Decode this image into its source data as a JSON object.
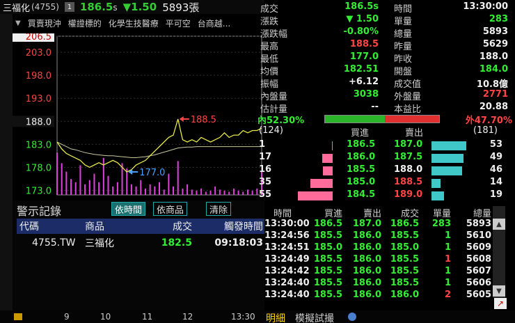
{
  "header": {
    "name": "三福化",
    "code": "(4755)",
    "info_btn": "1",
    "price": "186.5",
    "price_suffix": "s",
    "change": "▼1.50",
    "volume": "5893張"
  },
  "tags": [
    "買賣現沖",
    "權證標的",
    "化學生技醫療",
    "平可空",
    "台商越..."
  ],
  "quote": {
    "rows": [
      [
        {
          "label": "成交",
          "value": "186.5s",
          "color": "green"
        },
        {
          "label": "時間",
          "value": "13:30:00",
          "color": "white"
        }
      ],
      [
        {
          "label": "漲跌",
          "value": "▼ 1.50",
          "color": "green"
        },
        {
          "label": "單量",
          "value": "283",
          "color": "green"
        }
      ],
      [
        {
          "label": "漲跌幅",
          "value": "-0.80%",
          "color": "green"
        },
        {
          "label": "總量",
          "value": "5893",
          "color": "white"
        }
      ],
      [
        {
          "label": "最高",
          "value": "188.5",
          "color": "red"
        },
        {
          "label": "昨量",
          "value": "5629",
          "color": "white"
        }
      ],
      [
        {
          "label": "最低",
          "value": "177.0",
          "color": "green"
        },
        {
          "label": "昨收",
          "value": "188.0",
          "color": "white"
        }
      ],
      [
        {
          "label": "均價",
          "value": "182.51",
          "color": "green"
        },
        {
          "label": "開盤",
          "value": "184.0",
          "color": "green"
        }
      ],
      [
        {
          "label": "振幅",
          "value": "+6.12",
          "color": "white"
        },
        {
          "label": "成交值",
          "value": "10.8億",
          "color": "white"
        }
      ],
      [
        {
          "label": "內盤量",
          "value": "3038",
          "color": "green"
        },
        {
          "label": "外盤量",
          "value": "2771",
          "color": "red"
        }
      ],
      [
        {
          "label": "估計量",
          "value": "--",
          "color": "white"
        },
        {
          "label": "本益比",
          "value": "20.88",
          "color": "white"
        }
      ]
    ],
    "inner_pct": "內52.30%",
    "outer_pct": "外47.70%",
    "inner_ratio": 0.523
  },
  "book": {
    "bid_total": "(124)",
    "ask_total": "(181)",
    "bid_header": "買進",
    "ask_header": "賣出",
    "rows": [
      {
        "bid_qty": "1",
        "bid": "186.5",
        "ask": "187.0",
        "ask_qty": "53",
        "bid_color": "green",
        "ask_color": "green"
      },
      {
        "bid_qty": "17",
        "bid": "186.0",
        "ask": "187.5",
        "ask_qty": "49",
        "bid_color": "green",
        "ask_color": "green"
      },
      {
        "bid_qty": "16",
        "bid": "185.5",
        "ask": "188.0",
        "ask_qty": "46",
        "bid_color": "green",
        "ask_color": "white"
      },
      {
        "bid_qty": "35",
        "bid": "185.0",
        "ask": "188.5",
        "ask_qty": "14",
        "bid_color": "green",
        "ask_color": "red"
      },
      {
        "bid_qty": "55",
        "bid": "184.5",
        "ask": "189.0",
        "ask_qty": "19",
        "bid_color": "green",
        "ask_color": "red"
      }
    ],
    "bid_bar_frac": [
      0.02,
      0.31,
      0.29,
      0.64,
      1.0
    ],
    "ask_bar_frac": [
      1.0,
      0.92,
      0.87,
      0.26,
      0.36
    ]
  },
  "alerts": {
    "title": "警示記錄",
    "tabs": [
      "依時間",
      "依商品",
      "清除"
    ],
    "columns": [
      "代碼",
      "商品",
      "成交",
      "觸發時間"
    ],
    "rows": [
      {
        "code": "4755.TW",
        "name": "三福化",
        "price": "182.5",
        "time": "09:18:03"
      }
    ]
  },
  "trades": {
    "columns": [
      "時間",
      "買進",
      "賣出",
      "成交",
      "單量",
      "總量"
    ],
    "rows": [
      {
        "time": "13:30:00",
        "bid": "186.5",
        "ask": "187.0",
        "price": "186.5",
        "qty": "283",
        "total": "5893",
        "qty_color": "green"
      },
      {
        "time": "13:24:56",
        "bid": "185.5",
        "ask": "186.0",
        "price": "185.5",
        "qty": "1",
        "total": "5610",
        "qty_color": "green"
      },
      {
        "time": "13:24:51",
        "bid": "185.0",
        "ask": "186.0",
        "price": "185.0",
        "qty": "1",
        "total": "5609",
        "qty_color": "green"
      },
      {
        "time": "13:24:49",
        "bid": "185.5",
        "ask": "186.0",
        "price": "185.5",
        "qty": "1",
        "total": "5608",
        "qty_color": "red"
      },
      {
        "time": "13:24:42",
        "bid": "185.5",
        "ask": "186.0",
        "price": "185.5",
        "qty": "1",
        "total": "5607",
        "qty_color": "green"
      },
      {
        "time": "13:24:40",
        "bid": "185.5",
        "ask": "186.0",
        "price": "185.5",
        "qty": "1",
        "total": "5606",
        "qty_color": "green"
      },
      {
        "time": "13:24:40",
        "bid": "185.5",
        "ask": "186.0",
        "price": "186.0",
        "qty": "2",
        "total": "5605",
        "qty_color": "red"
      }
    ]
  },
  "bottom": {
    "x_ticks": [
      "9",
      "10",
      "11",
      "12",
      "13:30"
    ],
    "tabs": [
      "明細",
      "模擬試撮"
    ]
  },
  "chart_data": {
    "type": "line",
    "ylim": [
      172.0,
      206.5
    ],
    "y_ticks": [
      "206.5",
      "203.0",
      "198.0",
      "193.0",
      "188.0",
      "183.0",
      "178.0",
      "173.0"
    ],
    "y_tick_values": [
      206.5,
      203.0,
      198.0,
      193.0,
      188.0,
      183.0,
      178.0,
      173.0
    ],
    "reference": 188.0,
    "annotations": [
      {
        "label": "188.5",
        "value": 188.5
      },
      {
        "label": "177.0",
        "value": 177.0
      }
    ],
    "price_series": [
      183.5,
      182.0,
      181.0,
      180.5,
      180.0,
      179.5,
      178.5,
      178.0,
      178.5,
      179.0,
      178.5,
      179.0,
      179.5,
      179.0,
      178.0,
      177.0,
      177.5,
      178.5,
      179.0,
      179.5,
      180.5,
      181.5,
      182.5,
      183.5,
      184.5,
      185.0,
      188.5,
      184.0,
      183.5,
      184.0,
      183.5,
      184.5,
      184.0,
      183.5,
      184.0,
      184.5,
      185.5,
      184.5,
      185.0,
      185.0,
      186.0,
      185.5,
      186.0,
      186.0,
      186.5
    ],
    "avg_series": [
      183.5,
      183.0,
      182.5,
      182.0,
      181.8,
      181.5,
      181.2,
      181.0,
      180.8,
      180.7,
      180.6,
      180.5,
      180.5,
      180.4,
      180.3,
      180.2,
      180.1,
      180.1,
      180.2,
      180.3,
      180.5,
      180.7,
      181.0,
      181.3,
      181.6,
      181.9,
      182.2,
      182.3,
      182.4,
      182.4,
      182.5,
      182.5,
      182.5,
      182.5,
      182.5,
      182.5,
      182.5,
      182.5,
      182.5,
      182.5,
      182.5,
      182.5,
      182.5,
      182.5,
      182.5
    ],
    "volume_series": [
      40,
      30,
      22,
      15,
      12,
      28,
      10,
      14,
      20,
      12,
      35,
      18,
      8,
      12,
      30,
      25,
      10,
      8,
      14,
      6,
      10,
      8,
      12,
      5,
      20,
      8,
      32,
      6,
      10,
      5,
      4,
      6,
      3,
      4,
      8,
      5,
      4,
      3,
      6,
      4,
      3,
      5,
      4,
      6,
      22
    ],
    "volume_max": 45
  },
  "colors": {
    "up": "#ff4444",
    "down": "#33ee33",
    "flat": "#f0f0f0",
    "price_line": "#e8e84a",
    "avg_line": "#c8c8a0",
    "volume": "#e040e0",
    "bid_bar": "#ff6b9a",
    "ask_bar": "#40c8c8"
  }
}
